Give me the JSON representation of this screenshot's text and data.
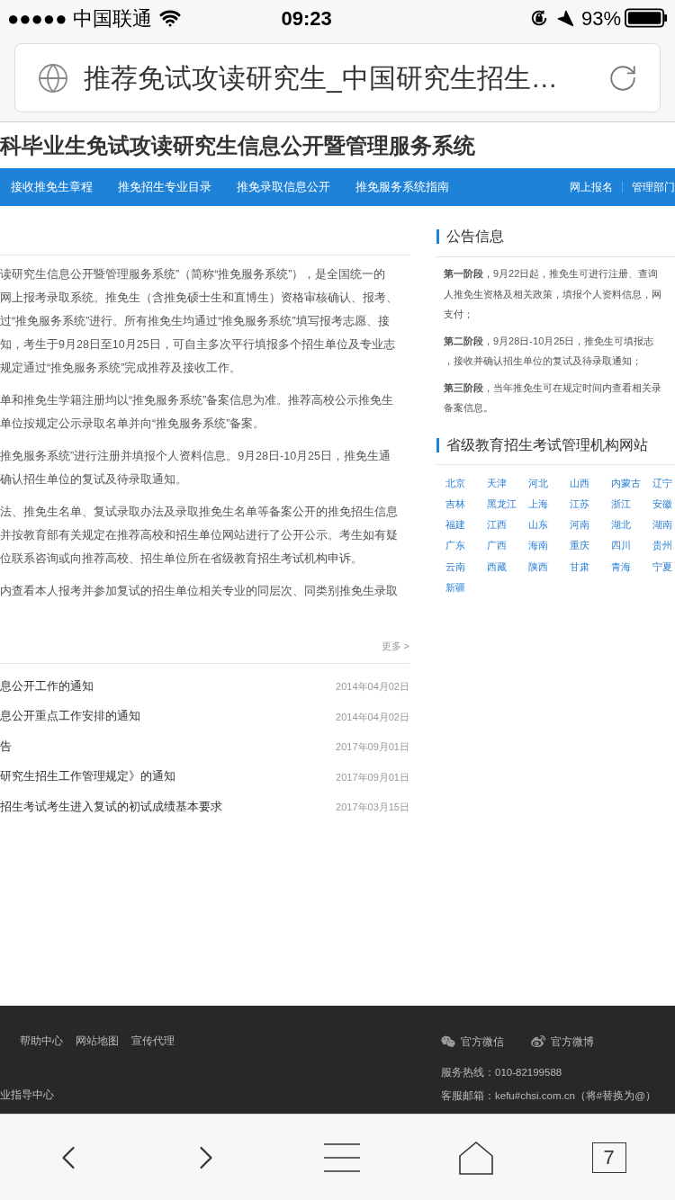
{
  "status_bar": {
    "carrier": "●●●●● 中国联通",
    "time": "09:23",
    "battery": "93%"
  },
  "address_bar": {
    "title": "推荐免试攻读研究生_中国研究生招生…"
  },
  "site_title": "科毕业生免试攻读研究生信息公开暨管理服务系统",
  "nav": {
    "left": [
      "接收推免生章程",
      "推免招生专业目录",
      "推免录取信息公开",
      "推免服务系统指南"
    ],
    "right": [
      "网上报名",
      "管理部门"
    ]
  },
  "intro": {
    "paragraphs": [
      [
        "读研究生信息公开暨管理服务系统”（简称“推免服务系统”），是全国统一的",
        "网上报考录取系统。推免生（含推免硕士生和直博生）资格审核确认、报考、",
        "过“推免服务系统”进行。所有推免生均通过“推免服务系统”填写报考志愿、接",
        "知，考生于9月28日至10月25日，可自主多次平行填报多个招生单位及专业志",
        "规定通过“推免服务系统”完成推荐及接收工作。"
      ],
      [
        "单和推免生学籍注册均以“推免服务系统”备案信息为准。推荐高校公示推免生",
        "单位按规定公示录取名单并向“推免服务系统”备案。"
      ],
      [
        "推免服务系统”进行注册并填报个人资料信息。9月28日-10月25日，推免生通",
        "确认招生单位的复试及待录取通知。"
      ],
      [
        "法、推免生名单、复试录取办法及录取推免生名单等备案公开的推免招生信息",
        "并按教育部有关规定在推荐高校和招生单位网站进行了公开公示。考生如有疑",
        "位联系咨询或向推荐高校、招生单位所在省级教育招生考试机构申诉。"
      ],
      [
        "内查看本人报考并参加复试的招生单位相关专业的同层次、同类别推免生录取"
      ]
    ]
  },
  "more": "更多 >",
  "news": [
    {
      "title": "息公开工作的通知",
      "date": "2014年04月02日"
    },
    {
      "title": "息公开重点工作安排的通知",
      "date": "2014年04月02日"
    },
    {
      "title": "告",
      "date": "2017年09月01日"
    },
    {
      "title": "研究生招生工作管理规定》的通知",
      "date": "2017年09月01日"
    },
    {
      "title": "招生考试考生进入复试的初试成绩基本要求",
      "date": "2017年03月15日"
    }
  ],
  "notices": {
    "heading": "公告信息",
    "paragraphs": [
      [
        "**第一阶段**，9月22日起，推免生可进行注册、查询",
        "人推免生资格及相关政策，填报个人资料信息，网",
        "支付；"
      ],
      [
        "**第二阶段**，9月28日-10月25日，推免生可填报志",
        "，接收并确认招生单位的复试及待录取通知；"
      ],
      [
        "**第三阶段**，当年推免生可在规定时间内查看相关录",
        "备案信息。"
      ]
    ]
  },
  "provinces": {
    "heading": "省级教育招生考试管理机构网站",
    "items": [
      "北京",
      "天津",
      "河北",
      "山西",
      "内蒙古",
      "辽宁",
      "吉林",
      "黑龙江",
      "上海",
      "江苏",
      "浙江",
      "安徽",
      "福建",
      "江西",
      "山东",
      "河南",
      "湖北",
      "湖南",
      "广东",
      "广西",
      "海南",
      "重庆",
      "四川",
      "贵州",
      "云南",
      "西藏",
      "陕西",
      "甘肃",
      "青海",
      "宁夏",
      "新疆"
    ]
  },
  "footer": {
    "links": [
      "帮助中心",
      "网站地图",
      "宣传代理"
    ],
    "bottom_left": "业指导中心",
    "social": [
      {
        "kind": "wechat",
        "label": "官方微信"
      },
      {
        "kind": "weibo",
        "label": "官方微博"
      }
    ],
    "hotline": "服务热线：010-82199588",
    "email": "客服邮箱：kefu#chsi.com.cn（将#替换为@）"
  },
  "toolbar": {
    "tabs_count": "7"
  }
}
